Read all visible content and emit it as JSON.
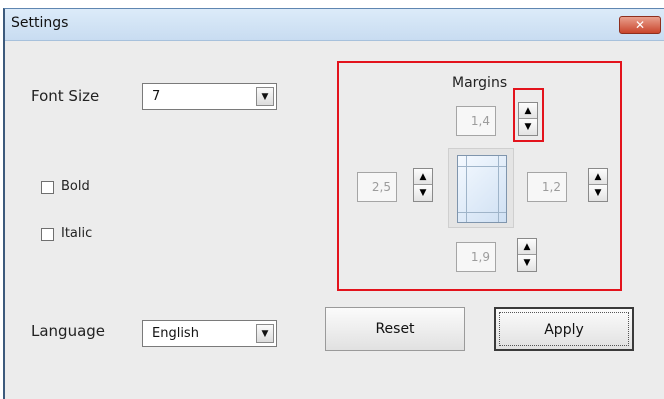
{
  "window": {
    "title": "Settings",
    "close_glyph": "✕"
  },
  "font_size": {
    "label": "Font Size",
    "value": "7",
    "dropdown_icon": "chevron-down-icon"
  },
  "style": {
    "bold_label": "Bold",
    "bold_checked": false,
    "italic_label": "Italic",
    "italic_checked": false
  },
  "margins": {
    "title": "Margins",
    "top": "1,4",
    "left": "2,5",
    "right": "1,2",
    "bottom": "1,9",
    "up_glyph": "▲",
    "down_glyph": "▼",
    "highlight_color": "#e3131c"
  },
  "language": {
    "label": "Language",
    "value": "English",
    "dropdown_icon": "chevron-down-icon"
  },
  "buttons": {
    "reset_label": "Reset",
    "apply_label": "Apply"
  },
  "glyphs": {
    "dropdown": "▼"
  }
}
